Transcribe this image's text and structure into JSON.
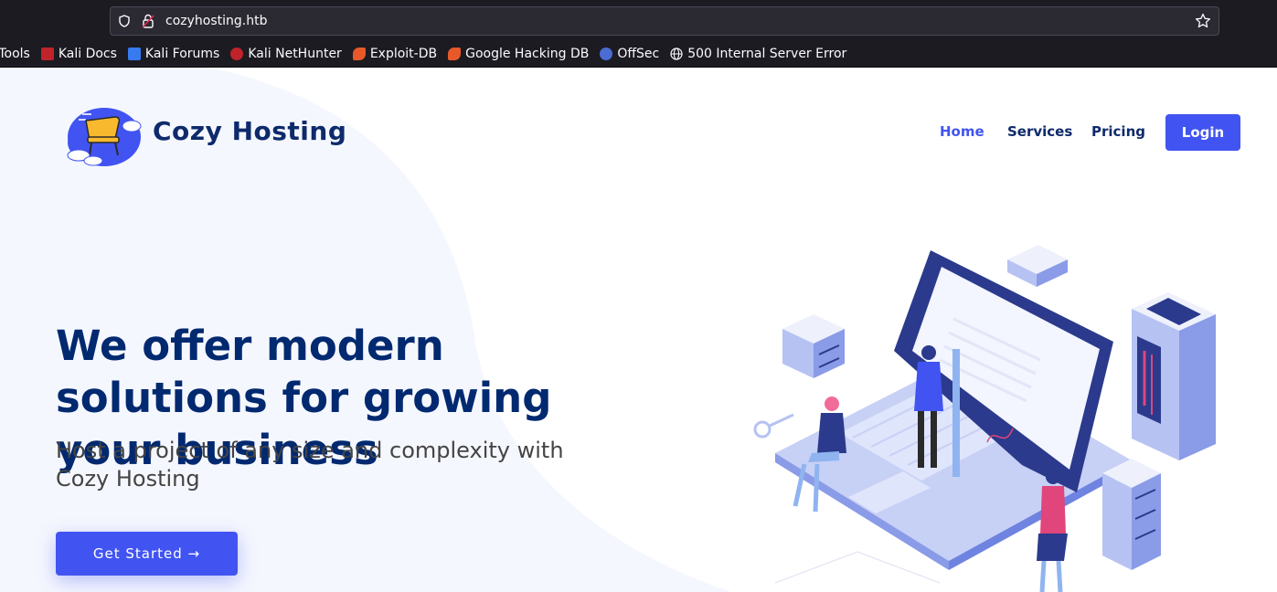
{
  "browser": {
    "url": "cozyhosting.htb",
    "bookmarks": [
      {
        "label": "i Tools",
        "icon": "kali-tools-icon",
        "color": "#367bf0"
      },
      {
        "label": "Kali Docs",
        "icon": "kali-docs-icon",
        "color": "#c0232a"
      },
      {
        "label": "Kali Forums",
        "icon": "kali-forums-icon",
        "color": "#367bf0"
      },
      {
        "label": "Kali NetHunter",
        "icon": "kali-nethunter-icon",
        "color": "#c0232a"
      },
      {
        "label": "Exploit-DB",
        "icon": "exploit-db-icon",
        "color": "#e8592a"
      },
      {
        "label": "Google Hacking DB",
        "icon": "ghdb-icon",
        "color": "#e8592a"
      },
      {
        "label": "OffSec",
        "icon": "offsec-icon",
        "color": "#4a6cd4"
      },
      {
        "label": "500 Internal Server Error",
        "icon": "globe-icon",
        "color": "#fbfbfe"
      }
    ]
  },
  "header": {
    "brand": "Cozy Hosting",
    "nav": {
      "home": "Home",
      "services": "Services",
      "pricing": "Pricing",
      "login": "Login"
    }
  },
  "hero": {
    "title": "We offer modern solutions for growing your business",
    "subtitle": "Host a project of any size and complexity with Cozy Hosting",
    "cta": "Get Started →"
  },
  "colors": {
    "accent": "#4154f1",
    "heading": "#012970",
    "chrome": "#1c1b22"
  }
}
